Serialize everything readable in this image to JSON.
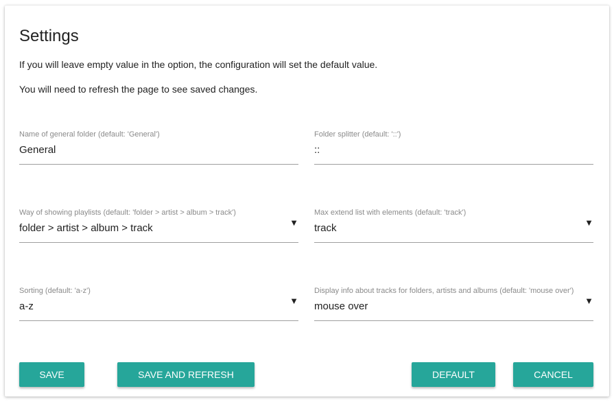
{
  "settings": {
    "title": "Settings",
    "info_empty": "If you will leave empty value in the option, the configuration will set the default value.",
    "info_refresh": "You will need to refresh the page to see saved changes."
  },
  "fields": {
    "general_folder": {
      "label": "Name of general folder (default: 'General')",
      "value": "General"
    },
    "folder_splitter": {
      "label": "Folder splitter (default: '::')",
      "value": "::"
    },
    "playlist_way": {
      "label": "Way of showing playlists (default: 'folder > artist > album > track')",
      "value": "folder > artist > album > track"
    },
    "max_extend": {
      "label": "Max extend list with elements (default: 'track')",
      "value": "track"
    },
    "sorting": {
      "label": "Sorting (default: 'a-z')",
      "value": "a-z"
    },
    "display_info": {
      "label": "Display info about tracks for folders, artists and albums (default: 'mouse over')",
      "value": "mouse over"
    }
  },
  "buttons": {
    "save": "SAVE",
    "save_refresh": "SAVE AND REFRESH",
    "default": "DEFAULT",
    "cancel": "CANCEL"
  },
  "icons": {
    "dropdown": "▼"
  },
  "colors": {
    "accent": "#26a69a",
    "label": "#8a8a8a",
    "underline": "#9e9e9e"
  }
}
